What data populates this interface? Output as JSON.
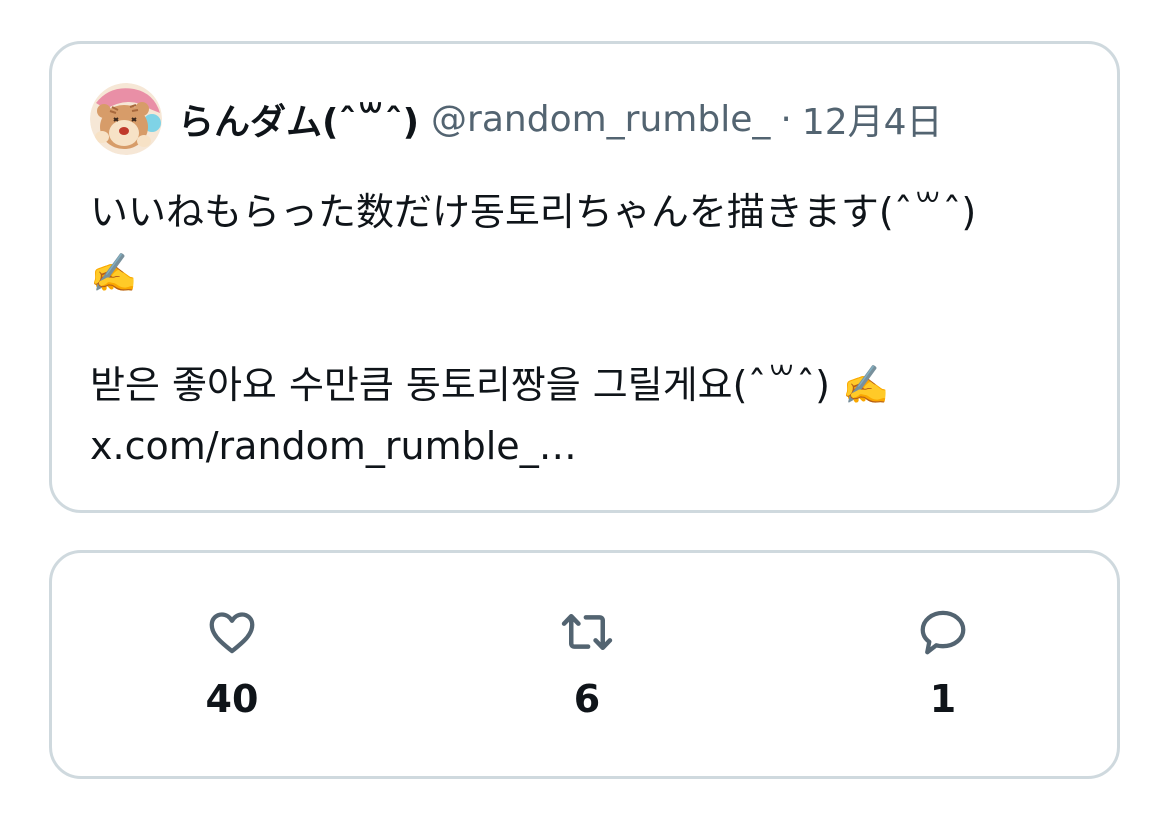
{
  "tweet": {
    "author": {
      "display_name": "らんダム(ˆ꒳ˆ)",
      "handle": "@random_rumble_",
      "avatar_icon": "hamster-avatar-icon"
    },
    "separator": "·",
    "date": "12月4日",
    "body_lines": [
      "いいねもらった数だけ동토리ちゃんを描きます(ˆ꒳ˆ)",
      "✍️",
      "받은 좋아요 수만큼 동토리짱을 그릴게요(ˆ꒳ˆ) ✍️",
      "x.com/random_rumble_…"
    ]
  },
  "stats": {
    "likes": {
      "icon": "heart-icon",
      "count": "40"
    },
    "retweets": {
      "icon": "retweet-icon",
      "count": "6"
    },
    "replies": {
      "icon": "reply-bubble-icon",
      "count": "1"
    }
  },
  "colors": {
    "border": "#cfd9de",
    "text_primary": "#0f1419",
    "text_secondary": "#536471"
  }
}
